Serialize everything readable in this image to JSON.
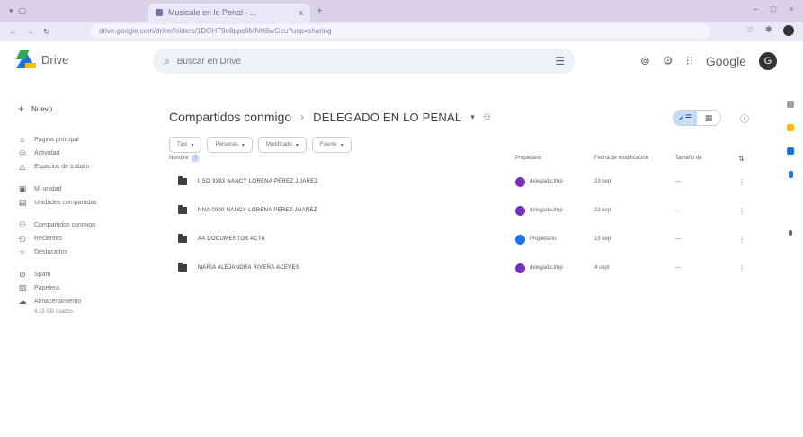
{
  "browser": {
    "tab_title": "Musicale en lo Penal - ...",
    "new_tab_label": "+",
    "url": "drive.google.com/drive/folders/1DOHT9o8ppc6MNH6wGeu?usp=sharing",
    "tab_close": "x",
    "window_controls": [
      "–",
      "□",
      "×"
    ],
    "nav_buttons": [
      "←",
      "→",
      "↻"
    ]
  },
  "header": {
    "app_name": "Drive",
    "search_placeholder": "Buscar en Drive",
    "google_label": "Google",
    "user_initial": "G"
  },
  "sidebar": {
    "new_label": "Nuevo",
    "items": [
      {
        "icon": "home-icon",
        "glyph": "⌂",
        "label": "Página principal"
      },
      {
        "icon": "activity-icon",
        "glyph": "◎",
        "label": "Actividad"
      },
      {
        "icon": "workspaces-icon",
        "glyph": "△",
        "label": "Espacios de trabajo"
      }
    ],
    "items2": [
      {
        "icon": "my-drive-icon",
        "glyph": "▣",
        "label": "Mi unidad"
      },
      {
        "icon": "shared-drives-icon",
        "glyph": "▤",
        "label": "Unidades compartidas"
      }
    ],
    "items3": [
      {
        "icon": "shared-with-me-icon",
        "glyph": "⚇",
        "label": "Compartidos conmigo"
      },
      {
        "icon": "recent-icon",
        "glyph": "◴",
        "label": "Recientes"
      },
      {
        "icon": "starred-icon",
        "glyph": "☆",
        "label": "Destacados"
      }
    ],
    "items4": [
      {
        "icon": "spam-icon",
        "glyph": "⊘",
        "label": "Spam"
      },
      {
        "icon": "trash-icon",
        "glyph": "▥",
        "label": "Papelera"
      },
      {
        "icon": "storage-icon",
        "glyph": "☁",
        "label": "Almacenamiento"
      }
    ],
    "storage_text": "4,19 GB usados"
  },
  "main": {
    "breadcrumb_root": "Compartidos conmigo",
    "breadcrumb_sep": "›",
    "breadcrumb_current": "DELEGADO EN LO PENAL",
    "filters": [
      "Tipo",
      "Personas",
      "Modificado",
      "Fuente"
    ],
    "columns": {
      "name": "Nombre",
      "owner": "Propietario",
      "modified": "Fecha de modificación",
      "size": "Tamaño de"
    },
    "rows": [
      {
        "name": "USO 3333 NANCY LORENA PEREZ JUAREZ",
        "owner": "delegado.trhp",
        "owner_color": "#7b2fbf",
        "modified": "23 sept",
        "size": "—"
      },
      {
        "name": "NNA 0000 NANCY LORENA PEREZ JUAREZ",
        "owner": "delegado.trhp",
        "owner_color": "#7b2fbf",
        "modified": "22 sept",
        "size": "—"
      },
      {
        "name": "AA DOCUMENTOS ACTA",
        "owner": "Propietario",
        "owner_color": "#1a73e8",
        "modified": "15 sept",
        "size": "—"
      },
      {
        "name": "MARIA ALEJANDRA RIVERA ACEVES",
        "owner": "delegado.trhp",
        "owner_color": "#7b2fbf",
        "modified": "4 sept",
        "size": "—"
      }
    ]
  },
  "colors": {
    "accent": "#c7dbf7",
    "brand_blue": "#1a73e8",
    "browser_chrome": "#d8d1e8"
  }
}
